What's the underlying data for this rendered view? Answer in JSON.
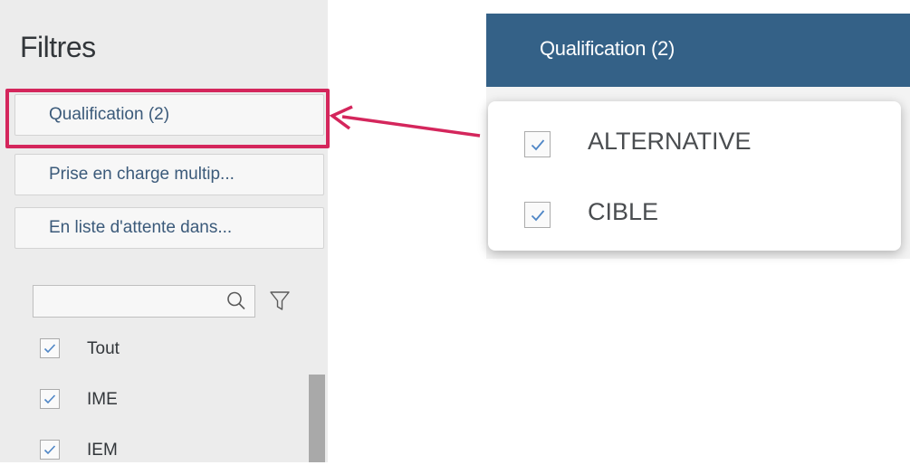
{
  "panel": {
    "title": "Filtres",
    "filters": [
      {
        "label": "Qualification (2)"
      },
      {
        "label": "Prise en charge multip..."
      },
      {
        "label": "En liste d'attente dans..."
      }
    ],
    "search": {
      "value": "",
      "placeholder": ""
    },
    "list_items": [
      {
        "label": "Tout",
        "checked": true
      },
      {
        "label": "IME",
        "checked": true
      },
      {
        "label": "IEM",
        "checked": true
      }
    ]
  },
  "popover": {
    "header": "Qualification (2)",
    "options": [
      {
        "label": "ALTERNATIVE",
        "checked": true
      },
      {
        "label": "CIBLE",
        "checked": true
      }
    ]
  },
  "icons": [
    "search-icon",
    "funnel-icon",
    "checkmark-icon",
    "arrow-annotation"
  ],
  "colors": {
    "header_bg": "#346187",
    "highlight": "#d4265c",
    "link_text": "#3b5a7a",
    "check": "#4f86c6",
    "panel_bg": "#ececec"
  }
}
